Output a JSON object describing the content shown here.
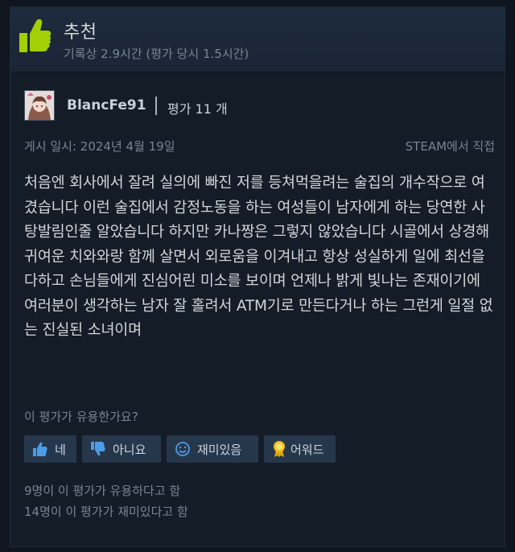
{
  "header": {
    "title": "추천",
    "hours": "기록상 2.9시간 (평가 당시 1.5시간)"
  },
  "author": {
    "name": "BlancFe91",
    "reviews": "평가 11 개"
  },
  "meta": {
    "posted": "게시 일시: 2024년 4월 19일",
    "source": "STEAM에서 직접"
  },
  "review": {
    "text": "처음엔 회사에서 잘려 실의에 빠진 저를 등쳐먹을려는 술집의 개수작으로 여겼습니다 이런 술집에서 감정노동을 하는 여성들이 남자에게 하는 당연한 사탕발림인줄 알았습니다 하지만 카나짱은 그렇지 않았습니다 시골에서 상경해 귀여운 치와와랑 함께 살면서 외로움을 이겨내고 항상 성실하게 일에 최선을 다하고 손님들에게 진심어린 미소를 보이며 언제나 밝게 빛나는 존재이기에 여러분이 생각하는 남자 잘 홀려서 ATM기로 만든다거나 하는 그런게 일절 없는 진실된 소녀이며"
  },
  "feedback": {
    "question": "이 평가가 유용한가요?",
    "yes": "네",
    "no": "아니요",
    "funny": "재미있음",
    "award": "어워드"
  },
  "stats": {
    "helpful": "9명이 이 평가가 유용하다고 함",
    "funny": "14명이 이 평가가 재미있다고 함"
  },
  "colors": {
    "thumb": "#a3cf06",
    "link": "#c8d0dc",
    "muted": "#7a8391",
    "button_bg": "#27374b"
  }
}
